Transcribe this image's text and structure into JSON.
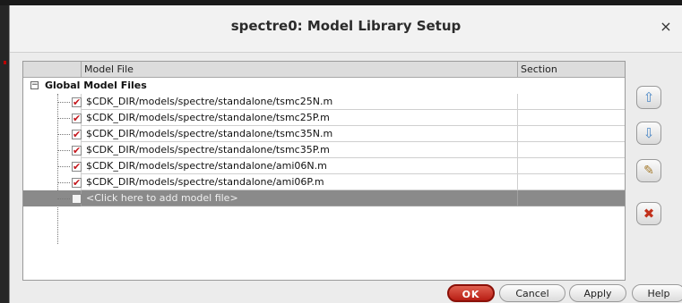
{
  "window": {
    "title": "spectre0: Model Library Setup",
    "close_glyph": "×"
  },
  "table": {
    "headers": {
      "model_file": "Model File",
      "section": "Section"
    },
    "group": {
      "label": "Global Model Files",
      "toggle_glyph": "−",
      "expanded": true
    },
    "rows": [
      {
        "checked": true,
        "file": "$CDK_DIR/models/spectre/standalone/tsmc25N.m",
        "section": ""
      },
      {
        "checked": true,
        "file": "$CDK_DIR/models/spectre/standalone/tsmc25P.m",
        "section": ""
      },
      {
        "checked": true,
        "file": "$CDK_DIR/models/spectre/standalone/tsmc35N.m",
        "section": ""
      },
      {
        "checked": true,
        "file": "$CDK_DIR/models/spectre/standalone/tsmc35P.m",
        "section": ""
      },
      {
        "checked": true,
        "file": "$CDK_DIR/models/spectre/standalone/ami06N.m",
        "section": ""
      },
      {
        "checked": true,
        "file": "$CDK_DIR/models/spectre/standalone/ami06P.m",
        "section": ""
      }
    ],
    "add_row": {
      "label": "<Click here to add model file>",
      "checked": false
    }
  },
  "side_buttons": {
    "move_up": {
      "icon": "arrow-up-icon",
      "glyph": "⇧"
    },
    "move_down": {
      "icon": "arrow-down-icon",
      "glyph": "⇩"
    },
    "edit": {
      "icon": "edit-icon",
      "glyph": "✎"
    },
    "delete": {
      "icon": "delete-icon",
      "glyph": "✖"
    }
  },
  "footer": {
    "ok": "OK",
    "cancel": "Cancel",
    "apply": "Apply",
    "help": "Help"
  },
  "colors": {
    "ok_button": "#b81e14",
    "check_mark": "#c4161c",
    "add_row_bg": "#8a8a8a",
    "arrow_blue": "#4a86c5"
  }
}
